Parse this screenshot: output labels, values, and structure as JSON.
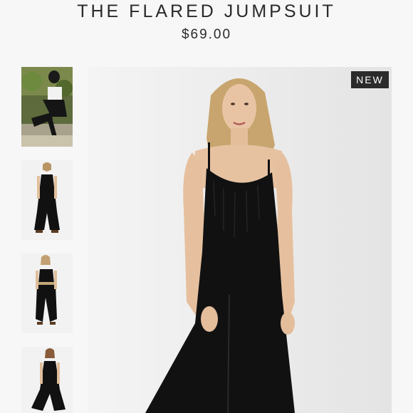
{
  "product": {
    "title": "THE FLARED JUMPSUIT",
    "price": "$69.00",
    "badge": "NEW"
  },
  "gallery": {
    "thumbnail_count": 4,
    "selected_index": 0
  },
  "colors": {
    "background": "#f7f7f7",
    "badge_background": "#2b2b2b",
    "garment": "#111111"
  }
}
